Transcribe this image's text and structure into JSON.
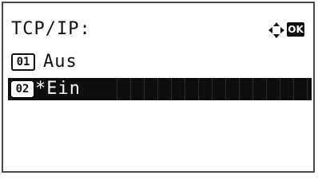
{
  "screen": {
    "title": "TCP/IP:",
    "ok_label": "OK"
  },
  "options": [
    {
      "number": "01",
      "label": "Aus",
      "selected": false
    },
    {
      "number": "02",
      "label": "*Ein",
      "selected": true
    }
  ],
  "colors": {
    "text": "#111111",
    "highlight_bg": "#0f0f0f",
    "background": "#ffffff"
  }
}
